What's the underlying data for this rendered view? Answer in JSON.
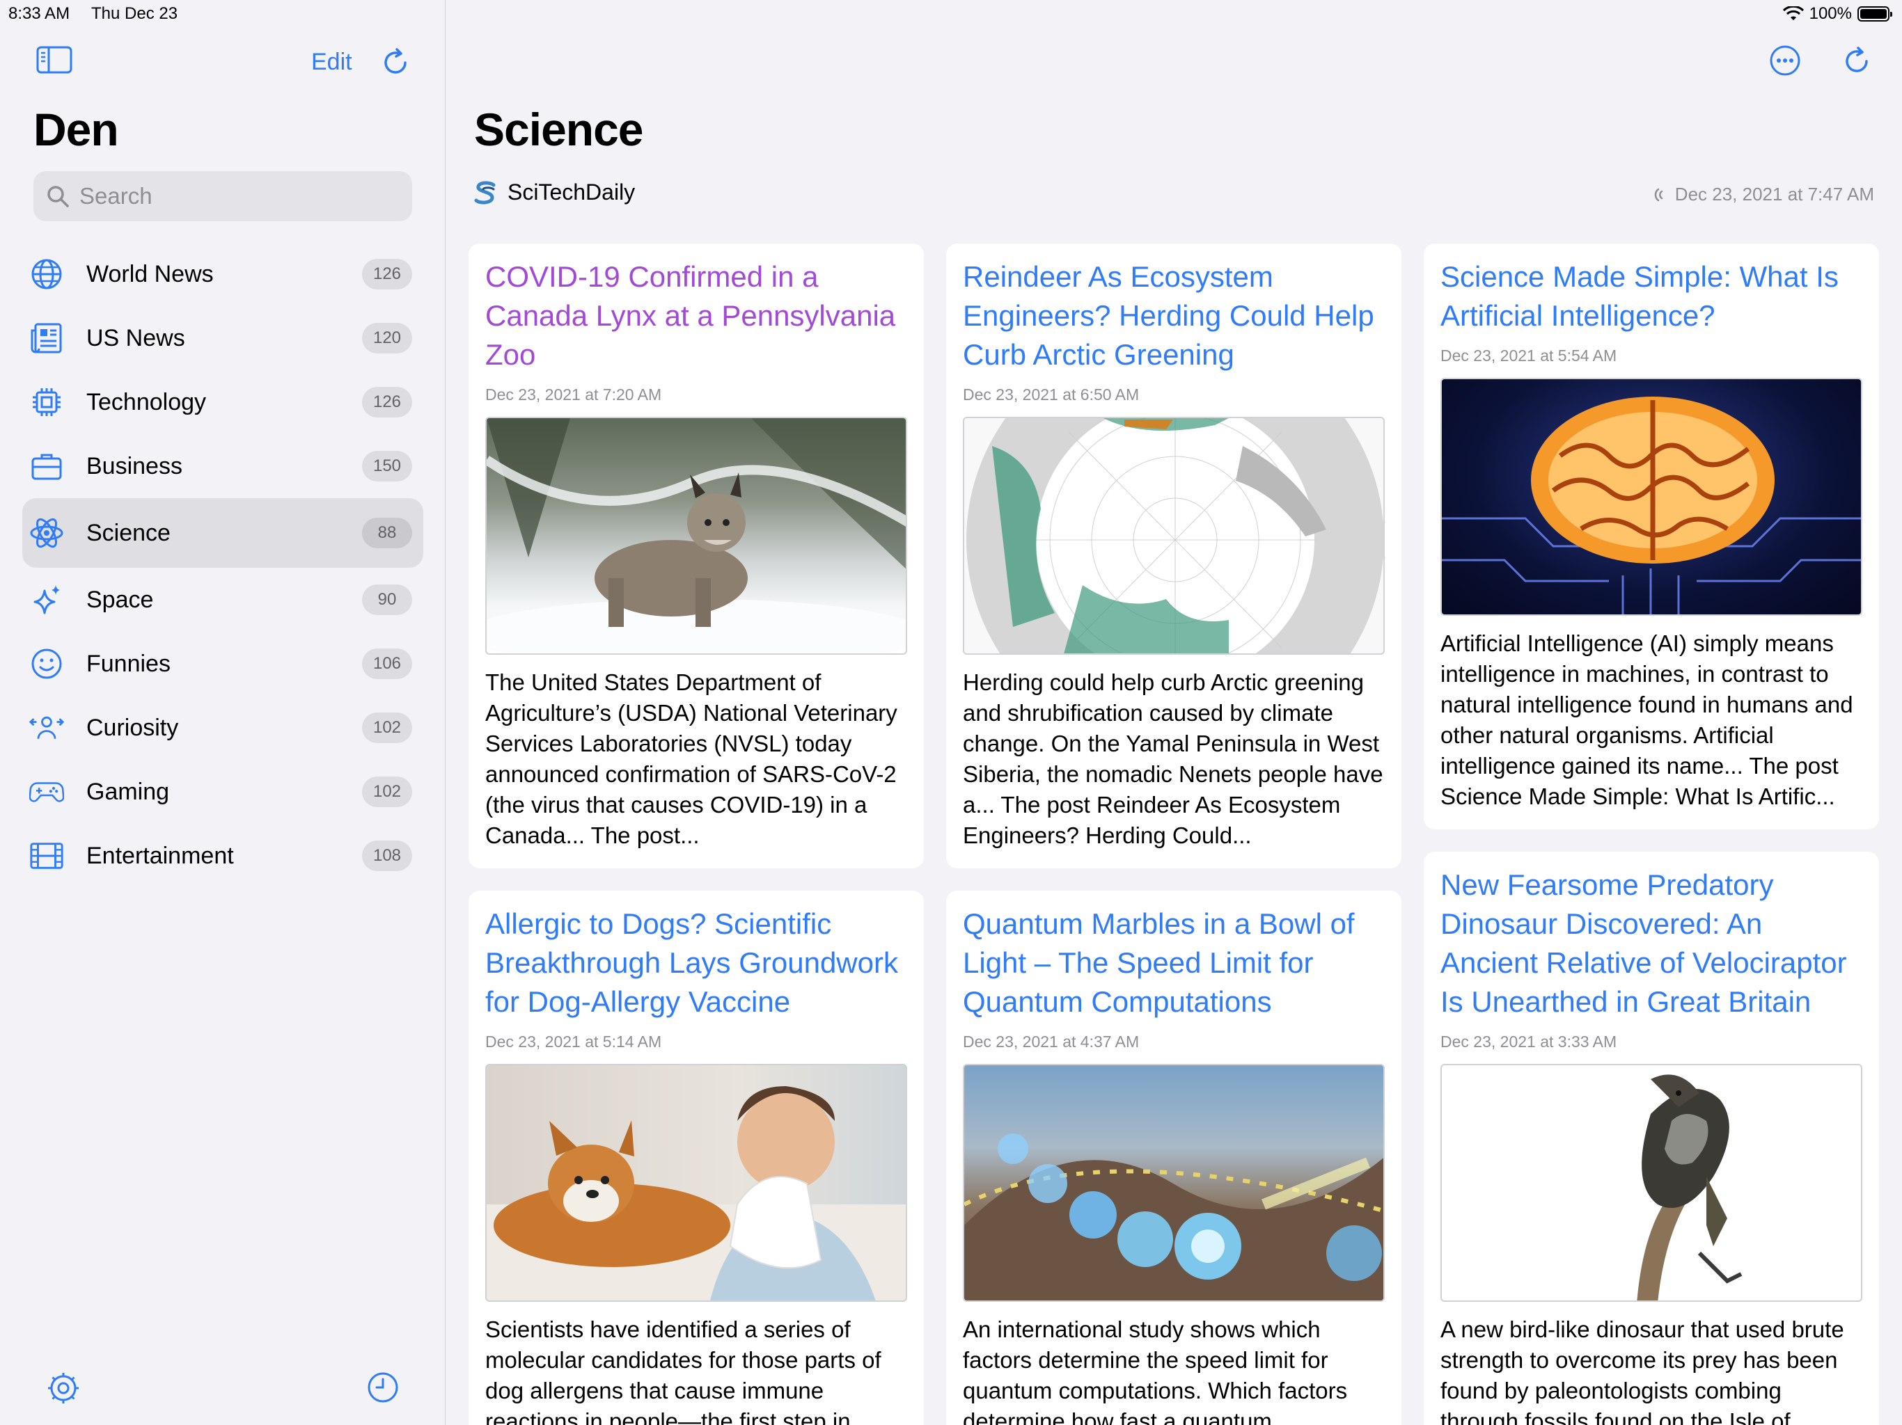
{
  "status": {
    "time": "8:33 AM",
    "date": "Thu Dec 23",
    "battery": "100%"
  },
  "sidebar": {
    "edit_label": "Edit",
    "title": "Den",
    "search_placeholder": "Search",
    "items": [
      {
        "label": "World News",
        "count": "126",
        "icon": "globe-icon"
      },
      {
        "label": "US News",
        "count": "120",
        "icon": "newspaper-icon"
      },
      {
        "label": "Technology",
        "count": "126",
        "icon": "cpu-icon"
      },
      {
        "label": "Business",
        "count": "150",
        "icon": "briefcase-icon"
      },
      {
        "label": "Science",
        "count": "88",
        "icon": "atom-icon",
        "active": true
      },
      {
        "label": "Space",
        "count": "90",
        "icon": "sparkles-icon"
      },
      {
        "label": "Funnies",
        "count": "106",
        "icon": "smiley-icon"
      },
      {
        "label": "Curiosity",
        "count": "102",
        "icon": "person-arrows-icon"
      },
      {
        "label": "Gaming",
        "count": "102",
        "icon": "gamecontroller-icon"
      },
      {
        "label": "Entertainment",
        "count": "108",
        "icon": "film-icon"
      }
    ]
  },
  "main": {
    "title": "Science",
    "source": "SciTechDaily",
    "updated": "Dec 23, 2021 at 7:47 AM",
    "articles": [
      {
        "title": "COVID-19 Confirmed in a Canada Lynx at a Pennsylvania Zoo",
        "date": "Dec 23, 2021 at 7:20 AM",
        "desc": "The United States Department of Agriculture’s (USDA) National Veterinary Services Laboratories (NVSL) today announced confirmation of SARS-CoV-2 (the virus that causes COVID-19) in a Canada... The post...",
        "visited": true
      },
      {
        "title": "Reindeer As Ecosystem Engineers? Herding Could Help Curb Arctic Greening",
        "date": "Dec 23, 2021 at 6:50 AM",
        "desc": "Herding could help curb Arctic greening and shrubification caused by climate change. On the Yamal Peninsula in West Siberia, the nomadic Nenets people have a... The post Reindeer As Ecosystem Engineers? Herding Could..."
      },
      {
        "title": "Science Made Simple: What Is Artificial Intelligence?",
        "date": "Dec 23, 2021 at 5:54 AM",
        "desc": "Artificial Intelligence (AI) simply means intelligence in machines, in contrast to natural intelligence found in humans and other natural organisms. Artificial intelligence gained its name... The post Science Made Simple: What Is Artific..."
      },
      {
        "title": "Allergic to Dogs? Scientific Breakthrough Lays Groundwork for Dog-Allergy Vaccine",
        "date": "Dec 23, 2021 at 5:14 AM",
        "desc": "Scientists have identified a series of molecular candidates for those parts of dog allergens that cause immune reactions in people—the first step in"
      },
      {
        "title": "Quantum Marbles in a Bowl of Light – The Speed Limit for Quantum Computations",
        "date": "Dec 23, 2021 at 4:37 AM",
        "desc": "An international study shows which factors determine the speed limit for quantum computations. Which factors determine how fast a quantum"
      },
      {
        "title": "New Fearsome Predatory Dinosaur Discovered: An Ancient Relative of Velociraptor Is Unearthed in Great Britain",
        "date": "Dec 23, 2021 at 3:33 AM",
        "desc": "A new bird-like dinosaur that used brute strength to overcome its prey has been found by paleontologists combing through fossils found on the Isle of"
      }
    ]
  }
}
